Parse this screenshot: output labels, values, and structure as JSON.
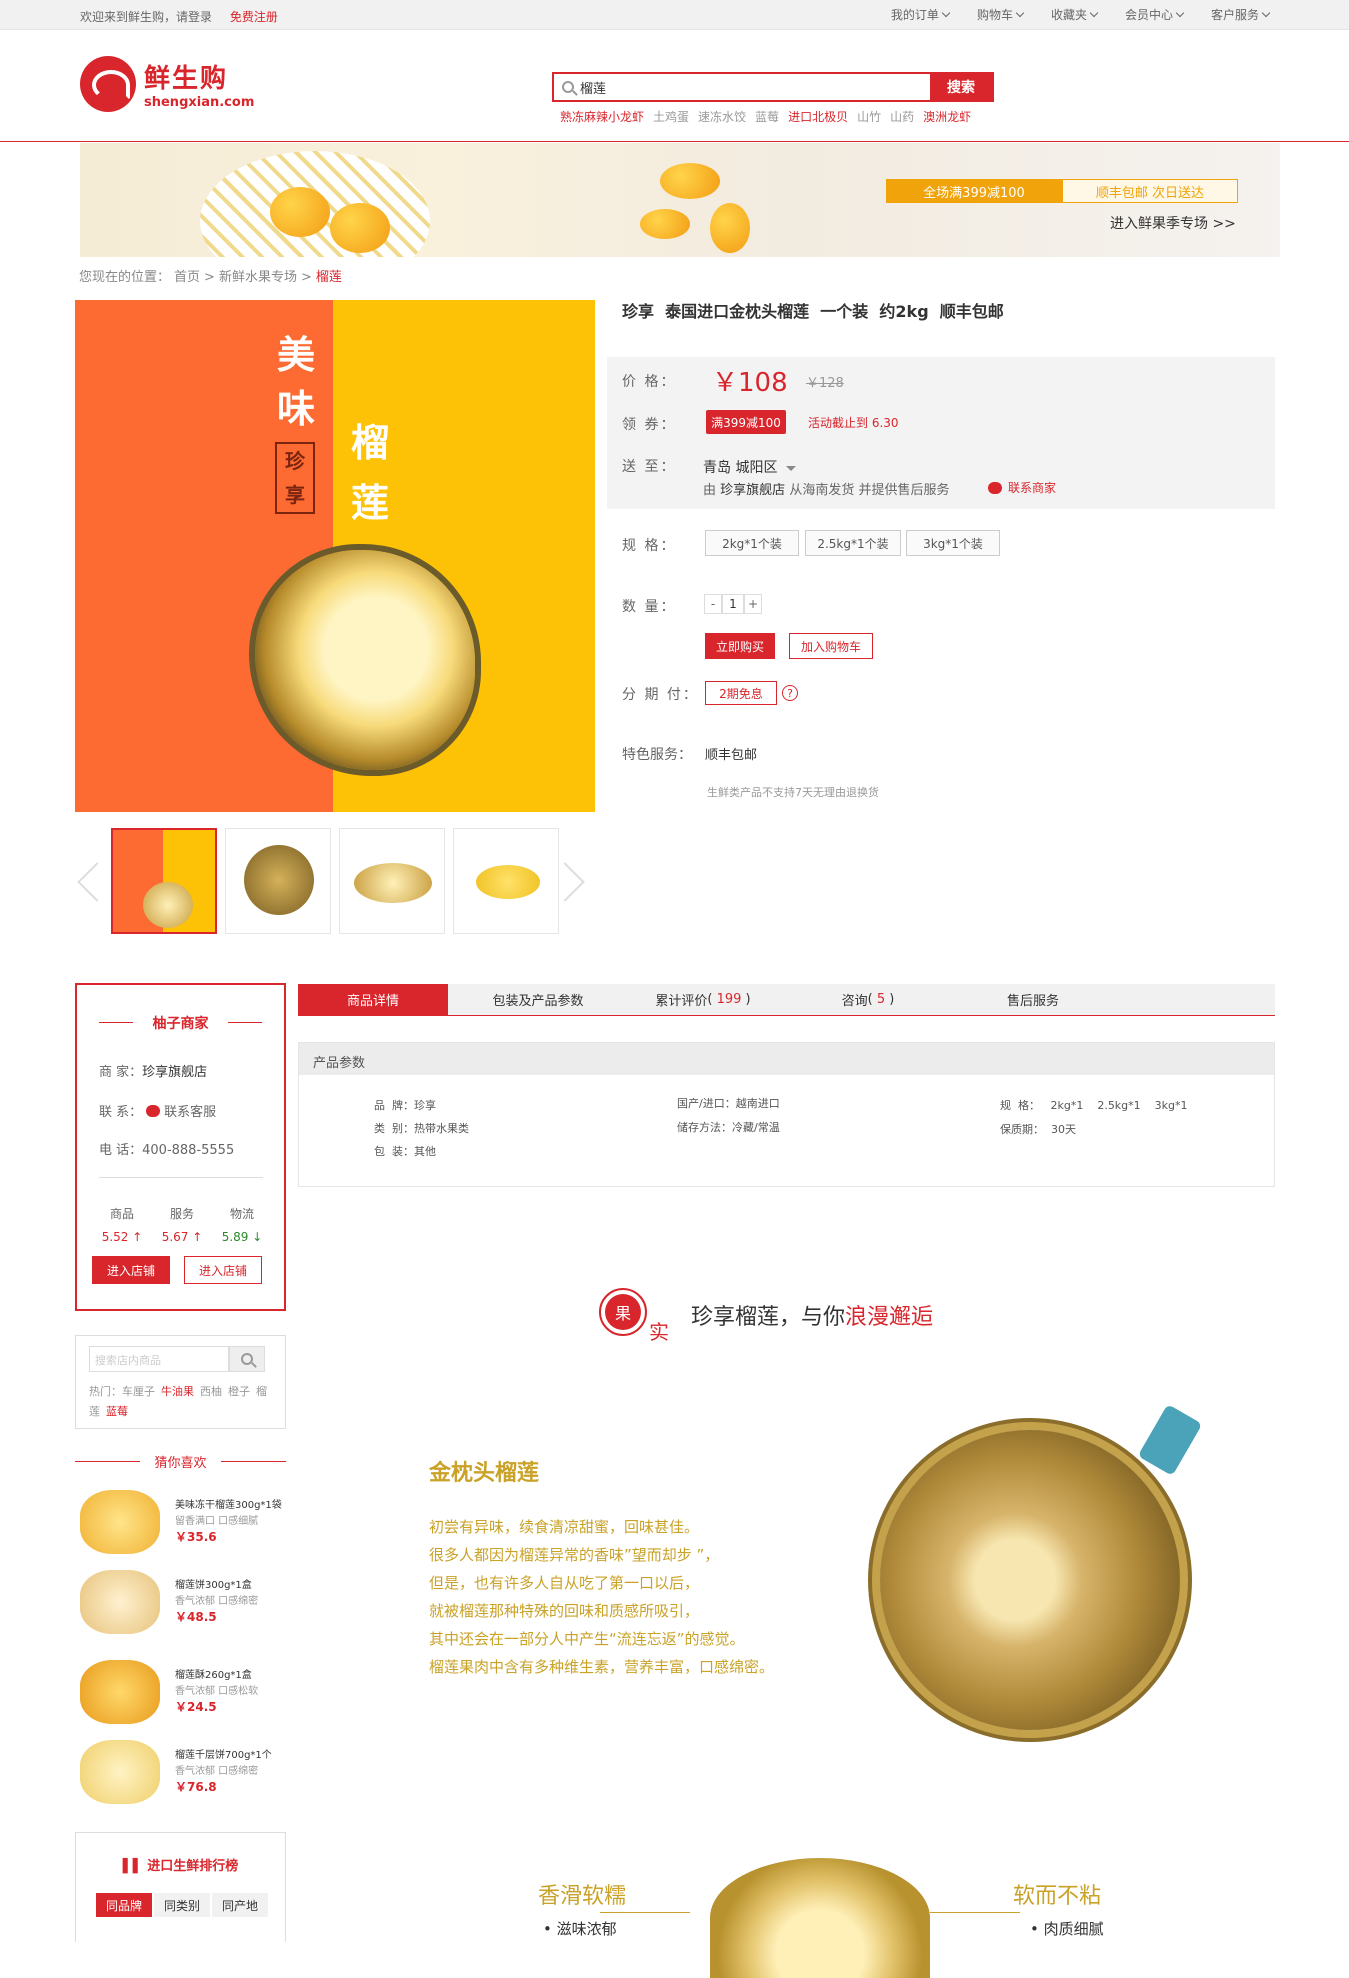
{
  "topbar": {
    "welcome": "欢迎来到鲜生购，请登录",
    "register": "免费注册",
    "menu": [
      "我的订单",
      "购物车",
      "收藏夹",
      "会员中心",
      "客户服务"
    ]
  },
  "logo": {
    "cn": "鲜生购",
    "en": "shengxian.com"
  },
  "search": {
    "value": "榴莲",
    "button": "搜索"
  },
  "hotwords": [
    {
      "text": "熟冻麻辣小龙虾",
      "hot": true
    },
    {
      "text": "土鸡蛋",
      "hot": false
    },
    {
      "text": "速冻水饺",
      "hot": false
    },
    {
      "text": "蓝莓",
      "hot": false
    },
    {
      "text": "进口北极贝",
      "hot": true
    },
    {
      "text": "山竹",
      "hot": false
    },
    {
      "text": "山药",
      "hot": false
    },
    {
      "text": "澳洲龙虾",
      "hot": true
    }
  ],
  "banner": {
    "promo": "全场满399减100",
    "shipping": "顺丰包邮  次日送达",
    "link": "进入鲜果季专场 >>"
  },
  "breadcrumb": {
    "label": "您现在的位置：",
    "items": [
      "首页",
      "新鲜水果专场"
    ],
    "current": "榴莲"
  },
  "main_image": {
    "chars_left": [
      "美",
      "味"
    ],
    "seal": [
      "珍",
      "享"
    ],
    "chars_right": [
      "榴",
      "莲"
    ]
  },
  "product": {
    "title": "珍享  泰国进口金枕头榴莲  一个装  约2kg  顺丰包邮",
    "price_label": "价    格：",
    "price": "￥108",
    "old_price": "￥128",
    "coupon_label": "领    券：",
    "coupon": "满399减100",
    "coupon_date": "活动截止到  6.30",
    "ship_label": "送    至：",
    "ship_to": "青岛  城阳区",
    "ship_from_prefix": "由",
    "ship_store": "珍享旗舰店",
    "ship_from_suffix": "从海南发货  并提供售后服务",
    "contact": "联系商家",
    "spec_label": "规    格：",
    "specs": [
      "2kg*1个装",
      "2.5kg*1个装",
      "3kg*1个装"
    ],
    "qty_label": "数    量：",
    "qty": "1",
    "buy_now": "立即购买",
    "add_cart": "加入购物车",
    "install_label": "分 期 付：",
    "install": "2期免息",
    "service_label": "特色服务：",
    "service": "顺丰包邮",
    "service_note": "生鲜类产品不支持7天无理由退换货"
  },
  "shop": {
    "title": "柚子商家",
    "name_label": "商 家：",
    "name": "珍享旗舰店",
    "contact_label": "联 系：",
    "contact": "联系客服",
    "phone": "电 话：400-888-5555",
    "scores": [
      {
        "label": "商品",
        "value": "5.52",
        "trend": "↑",
        "up": true
      },
      {
        "label": "服务",
        "value": "5.67",
        "trend": "↑",
        "up": true
      },
      {
        "label": "物流",
        "value": "5.89",
        "trend": "↓",
        "up": false
      }
    ],
    "enter1": "进入店铺",
    "enter2": "进入店铺"
  },
  "store_search": {
    "placeholder": "搜索店内商品",
    "hot_label": "热门：",
    "hot": [
      {
        "text": "车厘子",
        "hot": false
      },
      {
        "text": "牛油果",
        "hot": true
      },
      {
        "text": "西柚",
        "hot": false
      },
      {
        "text": "橙子",
        "hot": false
      },
      {
        "text": "榴莲",
        "hot": false
      },
      {
        "text": "蓝莓",
        "hot": true
      }
    ]
  },
  "guess": {
    "title": "猜你喜欢",
    "items": [
      {
        "name": "美味冻干榴莲300g*1袋",
        "desc": "留香满口  口感细腻",
        "price": "￥35.6"
      },
      {
        "name": "榴莲饼300g*1盒",
        "desc": "香气浓郁  口感绵密",
        "price": "￥48.5"
      },
      {
        "name": "榴莲酥260g*1盒",
        "desc": "香气浓郁  口感松软",
        "price": "￥24.5"
      },
      {
        "name": "榴莲千层饼700g*1个",
        "desc": "香气浓郁  口感绵密",
        "price": "￥76.8"
      }
    ]
  },
  "rank": {
    "title": "进口生鲜排行榜",
    "tabs": [
      "同品牌",
      "同类别",
      "同产地"
    ]
  },
  "tabs": [
    {
      "label": "商品详情",
      "count": ""
    },
    {
      "label": "包装及产品参数",
      "count": ""
    },
    {
      "label": "累计评价",
      "count": "199"
    },
    {
      "label": "咨询",
      "count": "5"
    },
    {
      "label": "售后服务",
      "count": ""
    }
  ],
  "params": {
    "title": "产品参数",
    "col1": [
      "品  牌：珍享",
      "类  别：热带水果类",
      "包  装：其他"
    ],
    "col2": [
      "国产/进口：越南进口",
      "储存方法：冷藏/常温"
    ],
    "col3": [
      "规  格：   2kg*1    2.5kg*1    3kg*1",
      "保质期：  30天"
    ]
  },
  "slogan": {
    "c1": "果",
    "c2": "实",
    "text": "珍享榴莲，与你",
    "hl": "浪漫邂逅"
  },
  "detail": {
    "name": "金枕头榴莲",
    "desc": "初尝有异味，续食清凉甜蜜，回味甚佳。\n很多人都因为榴莲异常的香味”望而却步 ”，\n但是，也有许多人自从吃了第一口以后，\n就被榴莲那种特殊的回味和质感所吸引，\n其中还会在一部分人中产生“流连忘返”的感觉。\n榴莲果肉中含有多种维生素，营养丰富，口感绵密。"
  },
  "features": [
    {
      "title": "香滑软糯",
      "point": "• 滋味浓郁"
    },
    {
      "title": "软而不粘",
      "point": "• 肉质细腻"
    }
  ]
}
